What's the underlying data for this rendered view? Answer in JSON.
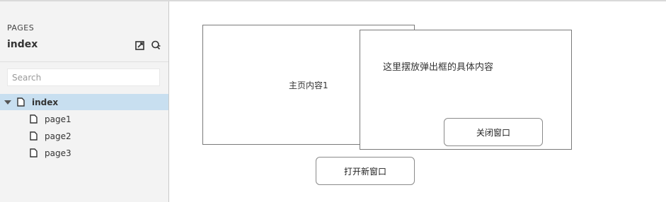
{
  "sidebar": {
    "section_label": "PAGES",
    "current_page": "index",
    "search": {
      "placeholder": "Search",
      "value": ""
    },
    "tree": [
      {
        "label": "index",
        "expanded": true,
        "selected": true,
        "icon": "page-icon"
      },
      {
        "label": "page1",
        "icon": "page-icon"
      },
      {
        "label": "page2",
        "icon": "page-icon"
      },
      {
        "label": "page3",
        "icon": "page-icon"
      }
    ],
    "tools": [
      "add-folder-icon",
      "page-options-icon"
    ]
  },
  "canvas": {
    "main_box": {
      "text": "主页内容1"
    },
    "popup": {
      "text": "这里摆放弹出框的具体内容",
      "close_button": "关闭窗口"
    },
    "open_button": "打开新窗口"
  },
  "colors": {
    "sidebar_bg": "#f3f3f3",
    "selected_row": "#c8dff0",
    "border": "#7a7a7a"
  }
}
